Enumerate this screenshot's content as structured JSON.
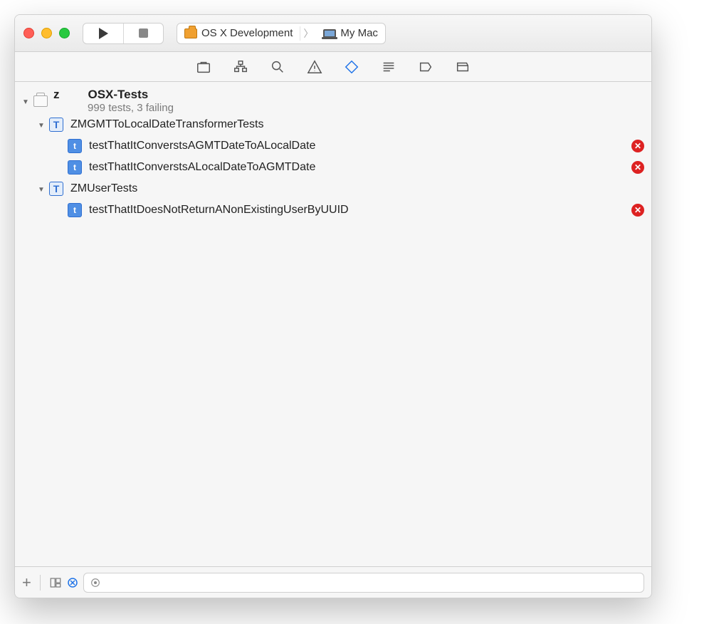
{
  "toolbar": {
    "scheme_name": "OS X Development",
    "destination_name": "My Mac"
  },
  "project": {
    "name": "z",
    "title": "OSX-Tests",
    "subtitle": "999 tests, 3 failing"
  },
  "groups": [
    {
      "name": "ZMGMTToLocalDateTransformerTests",
      "tests": [
        {
          "name": "testThatItConverstsAGMTDateToALocalDate",
          "failed": true
        },
        {
          "name": "testThatItConverstsALocalDateToAGMTDate",
          "failed": true
        }
      ]
    },
    {
      "name": "ZMUserTests",
      "tests": [
        {
          "name": "testThatItDoesNotReturnANonExistingUserByUUID",
          "failed": true
        }
      ]
    }
  ],
  "filter": {
    "placeholder": ""
  },
  "icons": {
    "class_letter": "T",
    "test_letter": "t",
    "fail_glyph": "✕"
  }
}
